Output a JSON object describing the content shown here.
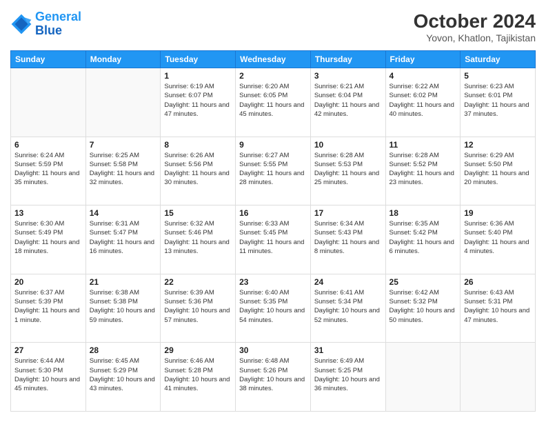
{
  "header": {
    "logo_line1": "General",
    "logo_line2": "Blue",
    "month": "October 2024",
    "location": "Yovon, Khatlon, Tajikistan"
  },
  "weekdays": [
    "Sunday",
    "Monday",
    "Tuesday",
    "Wednesday",
    "Thursday",
    "Friday",
    "Saturday"
  ],
  "weeks": [
    [
      {
        "day": "",
        "sunrise": "",
        "sunset": "",
        "daylight": ""
      },
      {
        "day": "",
        "sunrise": "",
        "sunset": "",
        "daylight": ""
      },
      {
        "day": "1",
        "sunrise": "Sunrise: 6:19 AM",
        "sunset": "Sunset: 6:07 PM",
        "daylight": "Daylight: 11 hours and 47 minutes."
      },
      {
        "day": "2",
        "sunrise": "Sunrise: 6:20 AM",
        "sunset": "Sunset: 6:05 PM",
        "daylight": "Daylight: 11 hours and 45 minutes."
      },
      {
        "day": "3",
        "sunrise": "Sunrise: 6:21 AM",
        "sunset": "Sunset: 6:04 PM",
        "daylight": "Daylight: 11 hours and 42 minutes."
      },
      {
        "day": "4",
        "sunrise": "Sunrise: 6:22 AM",
        "sunset": "Sunset: 6:02 PM",
        "daylight": "Daylight: 11 hours and 40 minutes."
      },
      {
        "day": "5",
        "sunrise": "Sunrise: 6:23 AM",
        "sunset": "Sunset: 6:01 PM",
        "daylight": "Daylight: 11 hours and 37 minutes."
      }
    ],
    [
      {
        "day": "6",
        "sunrise": "Sunrise: 6:24 AM",
        "sunset": "Sunset: 5:59 PM",
        "daylight": "Daylight: 11 hours and 35 minutes."
      },
      {
        "day": "7",
        "sunrise": "Sunrise: 6:25 AM",
        "sunset": "Sunset: 5:58 PM",
        "daylight": "Daylight: 11 hours and 32 minutes."
      },
      {
        "day": "8",
        "sunrise": "Sunrise: 6:26 AM",
        "sunset": "Sunset: 5:56 PM",
        "daylight": "Daylight: 11 hours and 30 minutes."
      },
      {
        "day": "9",
        "sunrise": "Sunrise: 6:27 AM",
        "sunset": "Sunset: 5:55 PM",
        "daylight": "Daylight: 11 hours and 28 minutes."
      },
      {
        "day": "10",
        "sunrise": "Sunrise: 6:28 AM",
        "sunset": "Sunset: 5:53 PM",
        "daylight": "Daylight: 11 hours and 25 minutes."
      },
      {
        "day": "11",
        "sunrise": "Sunrise: 6:28 AM",
        "sunset": "Sunset: 5:52 PM",
        "daylight": "Daylight: 11 hours and 23 minutes."
      },
      {
        "day": "12",
        "sunrise": "Sunrise: 6:29 AM",
        "sunset": "Sunset: 5:50 PM",
        "daylight": "Daylight: 11 hours and 20 minutes."
      }
    ],
    [
      {
        "day": "13",
        "sunrise": "Sunrise: 6:30 AM",
        "sunset": "Sunset: 5:49 PM",
        "daylight": "Daylight: 11 hours and 18 minutes."
      },
      {
        "day": "14",
        "sunrise": "Sunrise: 6:31 AM",
        "sunset": "Sunset: 5:47 PM",
        "daylight": "Daylight: 11 hours and 16 minutes."
      },
      {
        "day": "15",
        "sunrise": "Sunrise: 6:32 AM",
        "sunset": "Sunset: 5:46 PM",
        "daylight": "Daylight: 11 hours and 13 minutes."
      },
      {
        "day": "16",
        "sunrise": "Sunrise: 6:33 AM",
        "sunset": "Sunset: 5:45 PM",
        "daylight": "Daylight: 11 hours and 11 minutes."
      },
      {
        "day": "17",
        "sunrise": "Sunrise: 6:34 AM",
        "sunset": "Sunset: 5:43 PM",
        "daylight": "Daylight: 11 hours and 8 minutes."
      },
      {
        "day": "18",
        "sunrise": "Sunrise: 6:35 AM",
        "sunset": "Sunset: 5:42 PM",
        "daylight": "Daylight: 11 hours and 6 minutes."
      },
      {
        "day": "19",
        "sunrise": "Sunrise: 6:36 AM",
        "sunset": "Sunset: 5:40 PM",
        "daylight": "Daylight: 11 hours and 4 minutes."
      }
    ],
    [
      {
        "day": "20",
        "sunrise": "Sunrise: 6:37 AM",
        "sunset": "Sunset: 5:39 PM",
        "daylight": "Daylight: 11 hours and 1 minute."
      },
      {
        "day": "21",
        "sunrise": "Sunrise: 6:38 AM",
        "sunset": "Sunset: 5:38 PM",
        "daylight": "Daylight: 10 hours and 59 minutes."
      },
      {
        "day": "22",
        "sunrise": "Sunrise: 6:39 AM",
        "sunset": "Sunset: 5:36 PM",
        "daylight": "Daylight: 10 hours and 57 minutes."
      },
      {
        "day": "23",
        "sunrise": "Sunrise: 6:40 AM",
        "sunset": "Sunset: 5:35 PM",
        "daylight": "Daylight: 10 hours and 54 minutes."
      },
      {
        "day": "24",
        "sunrise": "Sunrise: 6:41 AM",
        "sunset": "Sunset: 5:34 PM",
        "daylight": "Daylight: 10 hours and 52 minutes."
      },
      {
        "day": "25",
        "sunrise": "Sunrise: 6:42 AM",
        "sunset": "Sunset: 5:32 PM",
        "daylight": "Daylight: 10 hours and 50 minutes."
      },
      {
        "day": "26",
        "sunrise": "Sunrise: 6:43 AM",
        "sunset": "Sunset: 5:31 PM",
        "daylight": "Daylight: 10 hours and 47 minutes."
      }
    ],
    [
      {
        "day": "27",
        "sunrise": "Sunrise: 6:44 AM",
        "sunset": "Sunset: 5:30 PM",
        "daylight": "Daylight: 10 hours and 45 minutes."
      },
      {
        "day": "28",
        "sunrise": "Sunrise: 6:45 AM",
        "sunset": "Sunset: 5:29 PM",
        "daylight": "Daylight: 10 hours and 43 minutes."
      },
      {
        "day": "29",
        "sunrise": "Sunrise: 6:46 AM",
        "sunset": "Sunset: 5:28 PM",
        "daylight": "Daylight: 10 hours and 41 minutes."
      },
      {
        "day": "30",
        "sunrise": "Sunrise: 6:48 AM",
        "sunset": "Sunset: 5:26 PM",
        "daylight": "Daylight: 10 hours and 38 minutes."
      },
      {
        "day": "31",
        "sunrise": "Sunrise: 6:49 AM",
        "sunset": "Sunset: 5:25 PM",
        "daylight": "Daylight: 10 hours and 36 minutes."
      },
      {
        "day": "",
        "sunrise": "",
        "sunset": "",
        "daylight": ""
      },
      {
        "day": "",
        "sunrise": "",
        "sunset": "",
        "daylight": ""
      }
    ]
  ]
}
